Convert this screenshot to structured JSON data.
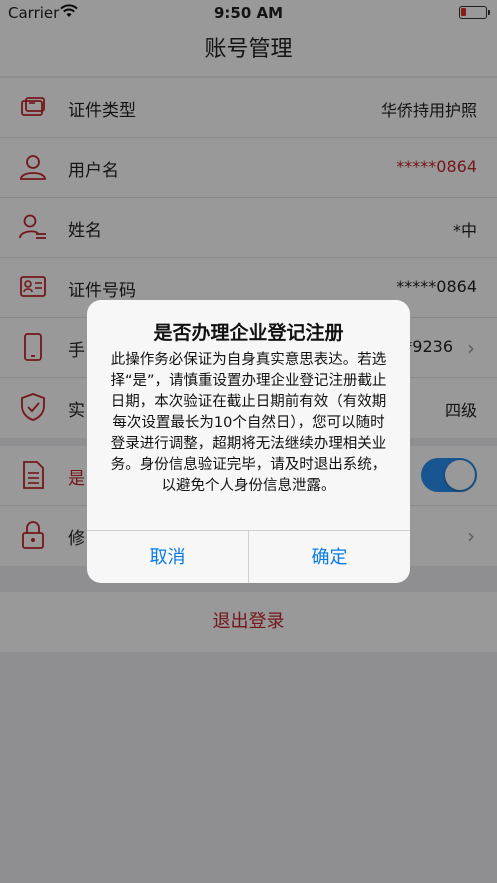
{
  "status_bar": {
    "carrier": "Carrier",
    "time": "9:50 AM"
  },
  "nav": {
    "title": "账号管理"
  },
  "rows_top": [
    {
      "label": "证件类型",
      "value": "华侨持用护照",
      "icon": "card-icon"
    },
    {
      "label": "用户名",
      "value": "*****0864",
      "icon": "user-icon"
    },
    {
      "label": "姓名",
      "value": "*中",
      "icon": "person-list-icon"
    },
    {
      "label": "证件号码",
      "value": "*****0864",
      "icon": "id-card-icon"
    },
    {
      "label": "手",
      "value": "*9236",
      "icon": "phone-icon"
    },
    {
      "label": "实",
      "value": "四级",
      "icon": "shield-icon"
    }
  ],
  "rows_bottom": [
    {
      "label": "是",
      "toggle_text": "是",
      "icon": "document-icon"
    },
    {
      "label": "修",
      "icon": "lock-icon"
    }
  ],
  "logout": {
    "label": "退出登录"
  },
  "alert": {
    "title": "是否办理企业登记注册",
    "message": "此操作务必保证为自身真实意思表达。若选择“是”，请慎重设置办理企业登记注册截止日期，本次验证在截止日期前有效（有效期每次设置最长为10个自然日），您可以随时登录进行调整，超期将无法继续办理相关业务。身份信息验证完毕，请及时退出系统，以避免个人身份信息泄露。",
    "cancel": "取消",
    "confirm": "确定"
  },
  "colors": {
    "accent_red": "#c0272d",
    "ios_blue": "#0a7ae8"
  }
}
